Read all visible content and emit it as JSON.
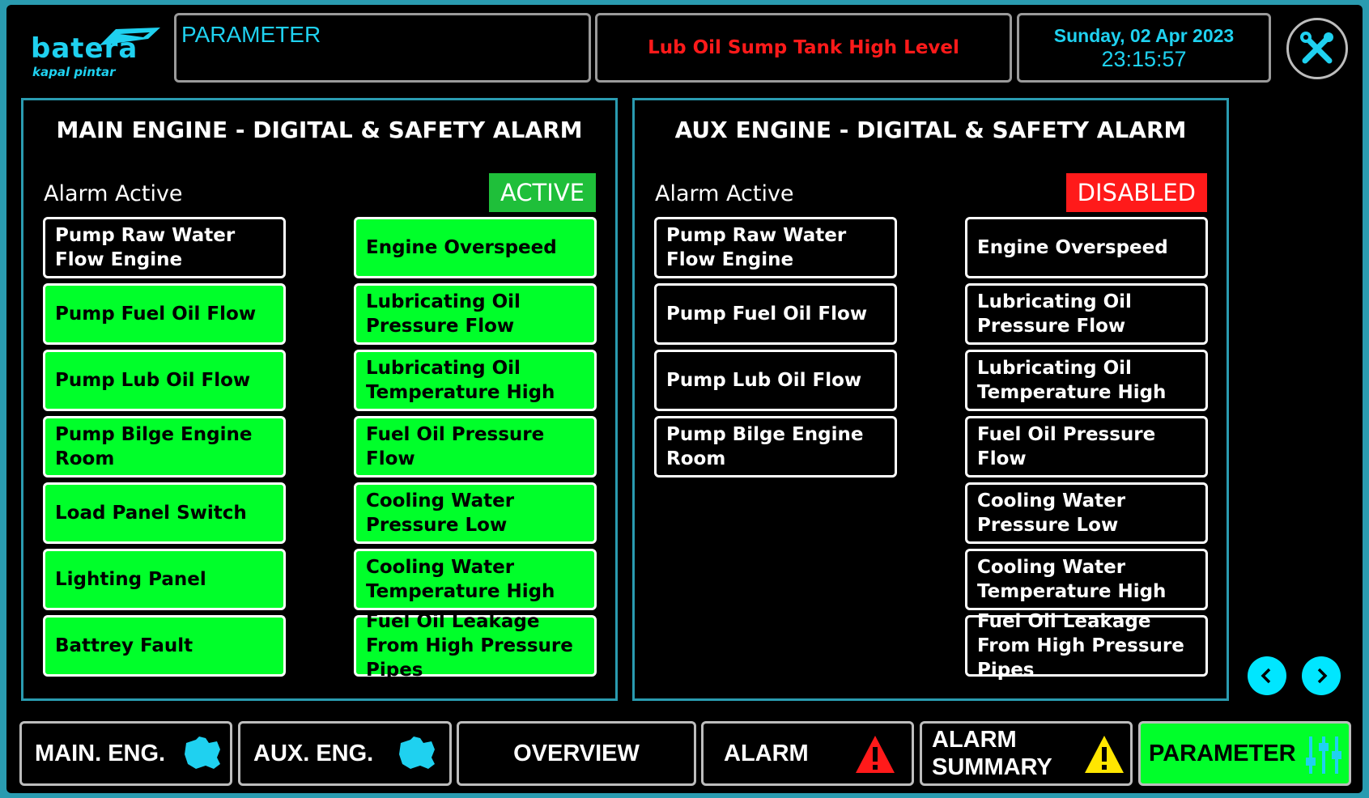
{
  "app": {
    "brand": "batera",
    "tagline": "kapal pintar"
  },
  "header": {
    "page_label": "PARAMETER",
    "current_alarm": "Lub Oil Sump Tank High Level",
    "date": "Sunday, 02 Apr 2023",
    "time": "23:15:57"
  },
  "colors": {
    "accent": "#1fd1f0",
    "active_green": "#00ff2a",
    "alarm_red": "#ff1a1a",
    "warning_yellow": "#ffe600"
  },
  "main_engine": {
    "title": "MAIN ENGINE - DIGITAL & SAFETY ALARM",
    "alarm_label": "Alarm Active",
    "status": "ACTIVE",
    "left_items": [
      {
        "label": "Pump Raw Water Flow Engine",
        "on": false
      },
      {
        "label": "Pump Fuel Oil Flow",
        "on": true
      },
      {
        "label": "Pump Lub Oil Flow",
        "on": true
      },
      {
        "label": "Pump Bilge Engine Room",
        "on": true
      },
      {
        "label": "Load Panel Switch",
        "on": true
      },
      {
        "label": "Lighting Panel",
        "on": true
      },
      {
        "label": "Battrey Fault",
        "on": true
      }
    ],
    "right_items": [
      {
        "label": "Engine Overspeed",
        "on": true
      },
      {
        "label": "Lubricating Oil Pressure Flow",
        "on": true
      },
      {
        "label": "Lubricating Oil Temperature High",
        "on": true
      },
      {
        "label": "Fuel Oil Pressure Flow",
        "on": true
      },
      {
        "label": "Cooling Water Pressure Low",
        "on": true
      },
      {
        "label": "Cooling Water Temperature High",
        "on": true
      },
      {
        "label": "Fuel Oil Leakage From High Pressure Pipes",
        "on": true
      }
    ]
  },
  "aux_engine": {
    "title": "AUX ENGINE - DIGITAL & SAFETY ALARM",
    "alarm_label": "Alarm Active",
    "status": "DISABLED",
    "left_items": [
      {
        "label": "Pump Raw Water Flow Engine",
        "on": false
      },
      {
        "label": "Pump Fuel Oil Flow",
        "on": false
      },
      {
        "label": "Pump Lub Oil Flow",
        "on": false
      },
      {
        "label": "Pump Bilge Engine Room",
        "on": false
      }
    ],
    "right_items": [
      {
        "label": "Engine Overspeed",
        "on": false
      },
      {
        "label": "Lubricating Oil Pressure Flow",
        "on": false
      },
      {
        "label": "Lubricating Oil Temperature High",
        "on": false
      },
      {
        "label": "Fuel Oil Pressure Flow",
        "on": false
      },
      {
        "label": "Cooling Water Pressure Low",
        "on": false
      },
      {
        "label": "Cooling Water Temperature High",
        "on": false
      },
      {
        "label": "Fuel Oil Leakage From High Pressure Pipes",
        "on": false
      }
    ]
  },
  "bottom_nav": {
    "main_eng": "MAIN. ENG.",
    "aux_eng": "AUX. ENG.",
    "overview": "OVERVIEW",
    "alarm": "ALARM",
    "alarm_summary_1": "ALARM",
    "alarm_summary_2": "SUMMARY",
    "parameter": "PARAMETER",
    "selected": "parameter"
  },
  "icons": {
    "tools": "tools-icon",
    "engine": "engine-icon",
    "alarm": "alarm-warning-icon",
    "alarm_summary": "warning-icon",
    "parameter": "sliders-icon",
    "prev": "chevron-left-icon",
    "next": "chevron-right-icon"
  }
}
